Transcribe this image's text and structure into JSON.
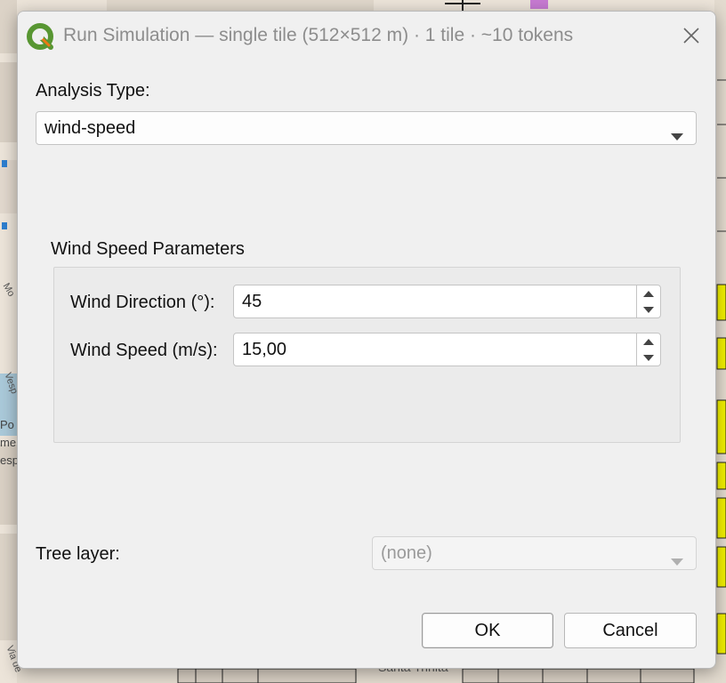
{
  "window": {
    "title": "Run Simulation — single tile (512×512 m) · 1 tile · ~10 tokens",
    "close_icon": "close-icon",
    "app_icon": "qgis-logo-icon"
  },
  "form": {
    "analysis_type_label": "Analysis Type:",
    "analysis_type_value": "wind-speed",
    "parameters_group_title": "Wind Speed Parameters",
    "wind_direction_label": "Wind Direction (°):",
    "wind_direction_value": "45",
    "wind_speed_label": "Wind Speed (m/s):",
    "wind_speed_value": "15,00",
    "tree_layer_label": "Tree layer:",
    "tree_layer_value": "(none)"
  },
  "buttons": {
    "ok_label": "OK",
    "cancel_label": "Cancel"
  },
  "map_labels": {
    "left_1": "Po",
    "left_2": "me",
    "left_3": "esp",
    "left_4": "Mo",
    "left_5": "Vesp",
    "left_6": "Via de",
    "bottom": "Santa Trinità"
  },
  "colors": {
    "dialog_bg": "#f0f0f0",
    "map_bg": "#ece4d9",
    "building_yellow": "#f3f200",
    "qgis_green": "#589632",
    "qgis_yellow": "#ee7913"
  }
}
